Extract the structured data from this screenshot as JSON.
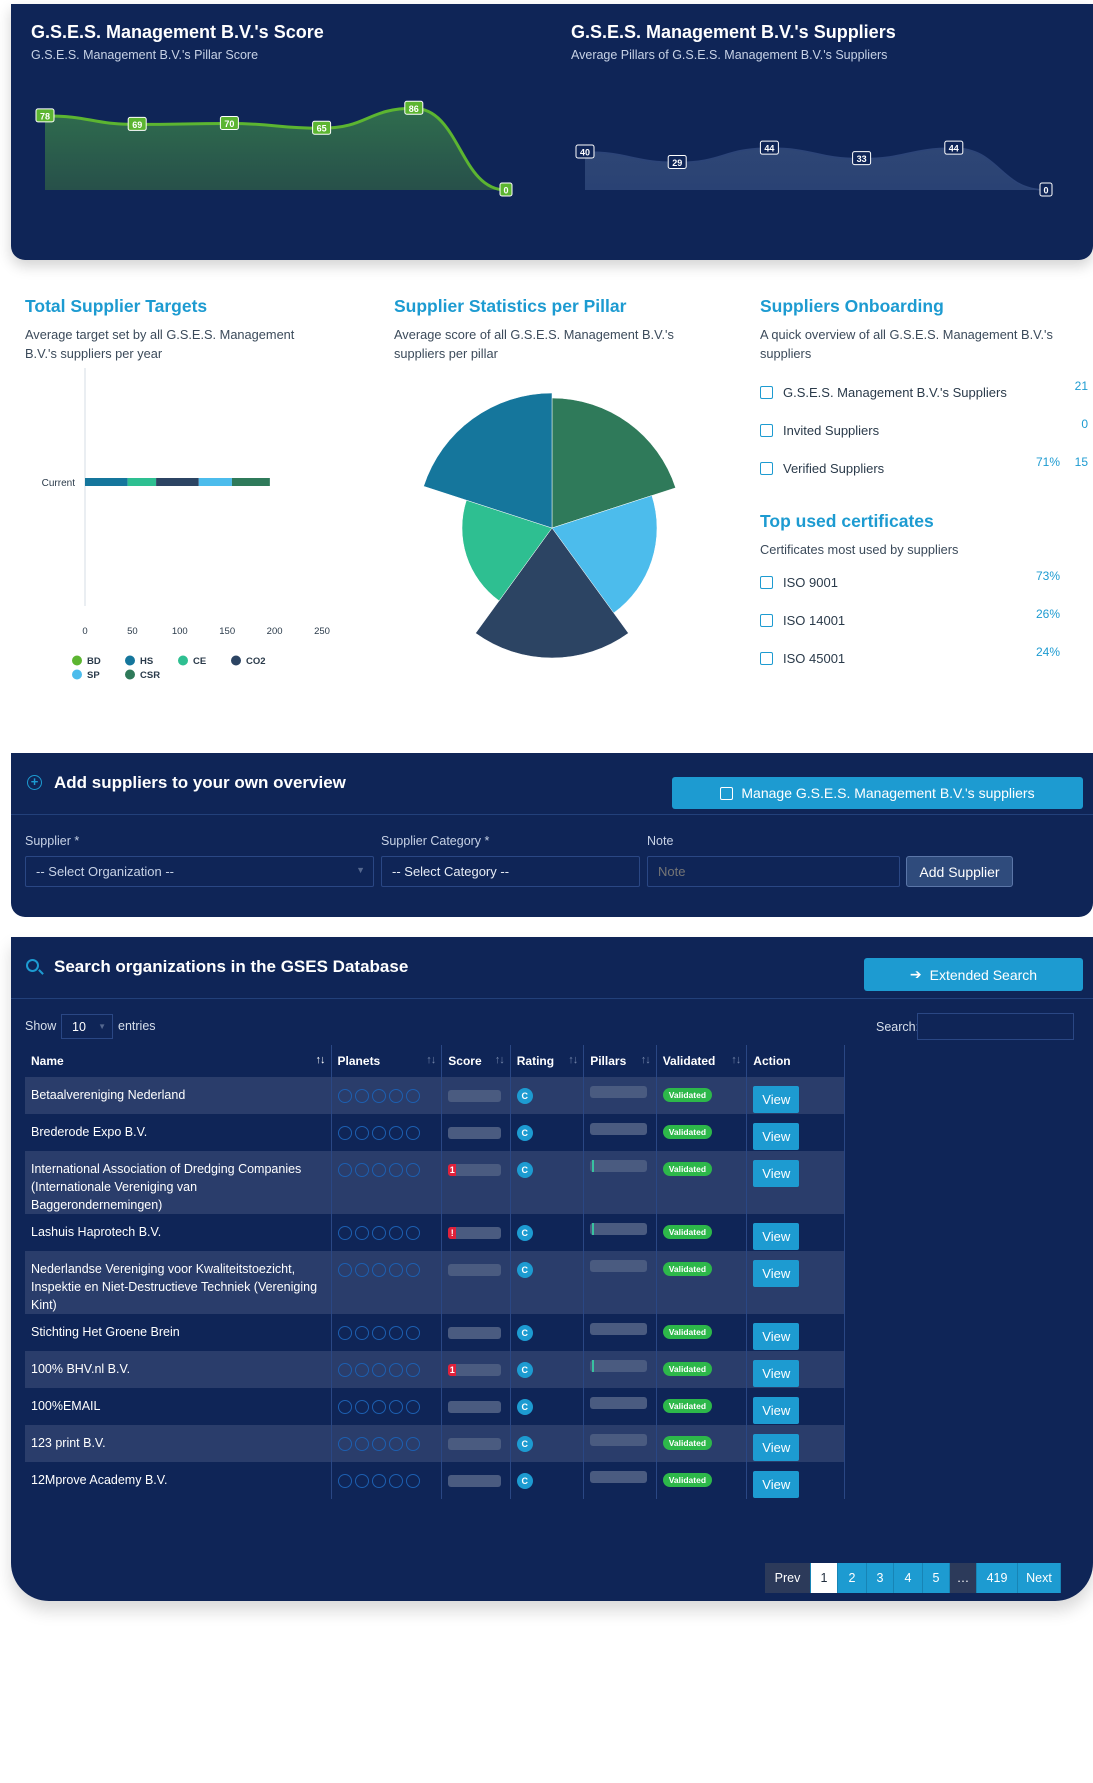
{
  "score_chart": {
    "title": "G.S.E.S. Management B.V.'s Score",
    "subtitle": "G.S.E.S. Management B.V.'s Pillar Score",
    "values": [
      78,
      69,
      70,
      65,
      86,
      0
    ],
    "color": "#5cb531"
  },
  "suppliers_chart": {
    "title": "G.S.E.S. Management B.V.'s Suppliers",
    "subtitle": "Average Pillars of G.S.E.S. Management B.V.'s Suppliers",
    "values": [
      40,
      29,
      44,
      33,
      44,
      0
    ],
    "color": "#2c4478"
  },
  "targets": {
    "title": "Total Supplier Targets",
    "subtitle": "Average target set by all G.S.E.S. Management B.V.'s suppliers per year",
    "chart_data": {
      "type": "bar",
      "orientation": "horizontal",
      "stacked": true,
      "categories": [
        "Current"
      ],
      "series": [
        {
          "name": "BD",
          "color": "#5cb531",
          "values": [
            0
          ]
        },
        {
          "name": "HS",
          "color": "#15769c",
          "values": [
            45
          ]
        },
        {
          "name": "CE",
          "color": "#2ebf91",
          "values": [
            30
          ]
        },
        {
          "name": "CO2",
          "color": "#2c4463",
          "values": [
            45
          ]
        },
        {
          "name": "SP",
          "color": "#4cbcec",
          "values": [
            35
          ]
        },
        {
          "name": "CSR",
          "color": "#2f7a5a",
          "values": [
            40
          ]
        }
      ],
      "x_ticks": [
        "0",
        "50",
        "100",
        "150",
        "200",
        "250"
      ],
      "xlim": [
        0,
        250
      ],
      "legend_position": "bottom"
    }
  },
  "stats": {
    "title": "Supplier Statistics per Pillar",
    "subtitle": "Average score of all G.S.E.S. Management B.V.'s suppliers per pillar",
    "chart_data": {
      "type": "polar_area",
      "slices": [
        {
          "color": "#2f7a5a",
          "value": 130
        },
        {
          "color": "#4cbcec",
          "value": 105
        },
        {
          "color": "#2c4463",
          "value": 130
        },
        {
          "color": "#2ebf91",
          "value": 90
        },
        {
          "color": "#15769c",
          "value": 135
        }
      ]
    }
  },
  "onboarding": {
    "title": "Suppliers Onboarding",
    "subtitle": "A quick overview of all G.S.E.S. Management B.V.'s suppliers",
    "rows": [
      {
        "label": "G.S.E.S. Management B.V.'s Suppliers",
        "pct": "",
        "value": "21"
      },
      {
        "label": "Invited Suppliers",
        "pct": "",
        "value": "0"
      },
      {
        "label": "Verified Suppliers",
        "pct": "71%",
        "value": "15"
      }
    ]
  },
  "certificates": {
    "title": "Top used certificates",
    "subtitle": "Certificates most used by suppliers",
    "rows": [
      {
        "label": "ISO 9001",
        "pct": "73%"
      },
      {
        "label": "ISO 14001",
        "pct": "26%"
      },
      {
        "label": "ISO 45001",
        "pct": "24%"
      }
    ]
  },
  "add_panel": {
    "title": "Add suppliers to your own overview",
    "manage_button": "Manage G.S.E.S. Management B.V.'s suppliers",
    "supplier_label": "Supplier *",
    "supplier_value": "-- Select Organization --",
    "category_label": "Supplier Category *",
    "category_value": "-- Select Category --",
    "note_label": "Note",
    "note_placeholder": "Note",
    "add_button": "Add Supplier"
  },
  "search_panel": {
    "title": "Search organizations in the GSES Database",
    "extended_button": "Extended Search",
    "show_label": "Show",
    "show_value": "10",
    "entries_label": "entries",
    "search_label": "Search:",
    "columns": [
      "Name",
      "Planets",
      "Score",
      "Rating",
      "Pillars",
      "Validated",
      "Action"
    ],
    "rating_letter": "C",
    "validated_label": "Validated",
    "view_label": "View",
    "rows": [
      {
        "name": "Betaalvereniging Nederland",
        "score_mark": "",
        "pillar_mark": false
      },
      {
        "name": "Brederode Expo B.V.",
        "score_mark": "",
        "pillar_mark": false
      },
      {
        "name": "International Association of Dredging Companies (Internationale Vereniging van Baggerondernemingen)",
        "score_mark": "1",
        "pillar_mark": true
      },
      {
        "name": "Lashuis Haprotech B.V.",
        "score_mark": "!",
        "pillar_mark": true
      },
      {
        "name": "Nederlandse Vereniging voor Kwaliteitstoezicht, Inspektie en Niet-Destructieve Techniek (Vereniging Kint)",
        "score_mark": "",
        "pillar_mark": false
      },
      {
        "name": "Stichting Het Groene Brein",
        "score_mark": "",
        "pillar_mark": false
      },
      {
        "name": "100% BHV.nl B.V.",
        "score_mark": "1",
        "pillar_mark": true
      },
      {
        "name": "100%EMAIL",
        "score_mark": "",
        "pillar_mark": false
      },
      {
        "name": "123 print B.V.",
        "score_mark": "",
        "pillar_mark": false
      },
      {
        "name": "12Mprove Academy B.V.",
        "score_mark": "",
        "pillar_mark": false
      }
    ],
    "pagination": [
      "Prev",
      "1",
      "2",
      "3",
      "4",
      "5",
      "…",
      "419",
      "Next"
    ]
  }
}
